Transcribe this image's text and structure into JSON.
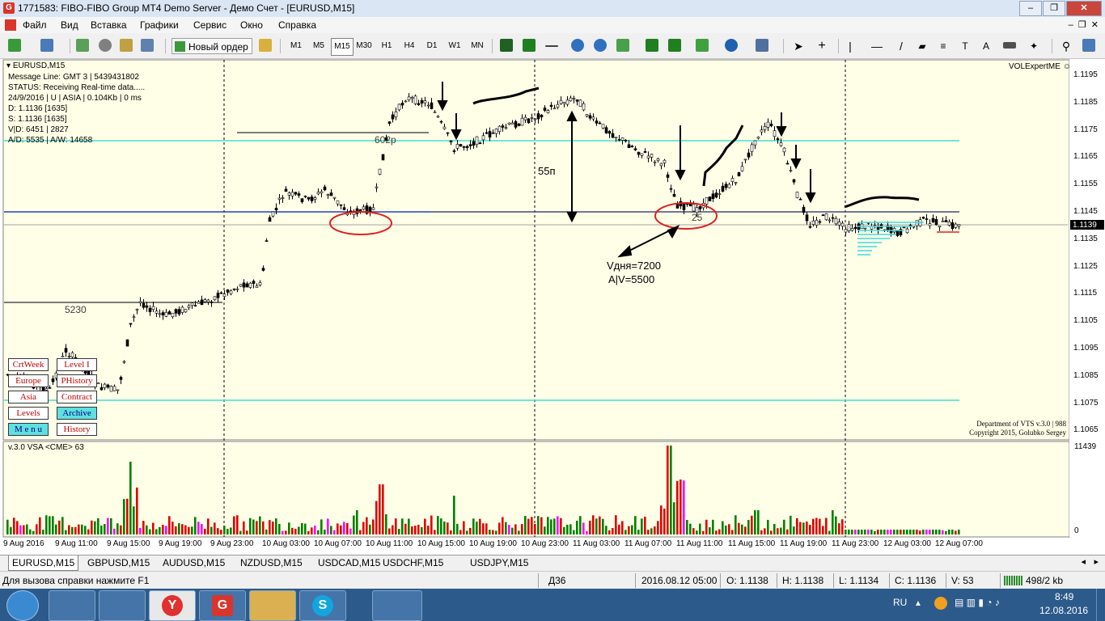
{
  "window": {
    "title": "1771583: FIBO-FIBO Group MT4 Demo Server - Демо Счет - [EURUSD,M15]",
    "app_icon_letter": "G",
    "minimize": "–",
    "restore": "❐",
    "close": "✕"
  },
  "menu": [
    "Файл",
    "Вид",
    "Вставка",
    "Графики",
    "Сервис",
    "Окно",
    "Справка"
  ],
  "toolbar": {
    "new_order": "Новый ордер",
    "timeframes": [
      "M1",
      "M5",
      "M15",
      "M30",
      "H1",
      "H4",
      "D1",
      "W1",
      "MN"
    ],
    "active_timeframe": "M15"
  },
  "chart": {
    "symbol_header": "EURUSD,M15",
    "info_lines": [
      "Message Line: GMT 3 | 5439431802",
      "STATUS:  Receiving Real-time data.....",
      "24/9/2016 | U | ASIA | 0.104Kb | 0 ms",
      "D: 1.1136  [1635]",
      "S: 1.1136  [1635]",
      "V|D: 6451 | 2827",
      "A/D: 5535 | A/W: 14658"
    ],
    "expert_label": "VOLExpertME",
    "price_labels": [
      "1.1195",
      "1.1185",
      "1.1175",
      "1.1165",
      "1.1155",
      "1.1145",
      "1.1135",
      "1.1125",
      "1.1115",
      "1.1105",
      "1.1095",
      "1.1085",
      "1.1075",
      "1.1065"
    ],
    "current_price": "1.1139",
    "annotations": {
      "level_5230": "5230",
      "level_602": "602р",
      "level_25": "25",
      "range_55": "55п",
      "vday": "Vдня=7200",
      "av": "A|V=5500"
    },
    "credits": [
      "Department of VTS  v.3.0 | 988",
      "Copyright 2015, Golubko Sergey"
    ],
    "buttons_left": [
      {
        "label": "CrtWeek",
        "style": "white"
      },
      {
        "label": "Europe",
        "style": "white"
      },
      {
        "label": "Asia",
        "style": "white"
      },
      {
        "label": "Levels",
        "style": "white"
      },
      {
        "label": "M e n u",
        "style": "cyan"
      }
    ],
    "buttons_right": [
      {
        "label": "Level I",
        "style": "white"
      },
      {
        "label": "PHistory",
        "style": "white"
      },
      {
        "label": "Contract",
        "style": "white"
      },
      {
        "label": "Archive",
        "style": "cyan"
      },
      {
        "label": "History",
        "style": "white"
      }
    ]
  },
  "volume_panel": {
    "label": "v.3.0 VSA <CME> 63",
    "scale_top": "11439",
    "scale_bottom": "0"
  },
  "time_axis": [
    "9 Aug 2016",
    "9 Aug 11:00",
    "9 Aug 15:00",
    "9 Aug 19:00",
    "9 Aug 23:00",
    "10 Aug 03:00",
    "10 Aug 07:00",
    "10 Aug 11:00",
    "10 Aug 15:00",
    "10 Aug 19:00",
    "10 Aug 23:00",
    "11 Aug 03:00",
    "11 Aug 07:00",
    "11 Aug 11:00",
    "11 Aug 15:00",
    "11 Aug 19:00",
    "11 Aug 23:00",
    "12 Aug 03:00",
    "12 Aug 07:00"
  ],
  "tabs": [
    "EURUSD,M15",
    "GBPUSD,M15",
    "AUDUSD,M15",
    "NZDUSD,M15",
    "USDCAD,M15",
    "USDCHF,M15",
    "USDJPY,M15"
  ],
  "status": {
    "help": "Для вызова справки нажмите F1",
    "profile": "Д36",
    "datetime": "2016.08.12 05:00",
    "open": "O: 1.1138",
    "high": "H: 1.1138",
    "low": "L: 1.1134",
    "close": "C: 1.1136",
    "volume": "V: 53",
    "traffic": "498/2 kb"
  },
  "taskbar": {
    "lang": "RU",
    "time": "8:49",
    "date": "12.08.2016"
  },
  "colors": {
    "chart_bg": "#ffffe8",
    "bull_volume": "#008000",
    "bear_volume": "#e00000",
    "cyan_level": "#40e0d0",
    "blue_level": "#2040c0",
    "ellipse": "#e02020"
  }
}
